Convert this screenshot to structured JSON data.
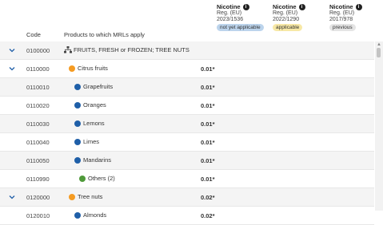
{
  "columns": {
    "code": "Code",
    "products": "Products to which MRLs apply"
  },
  "mrl_columns": [
    {
      "substance": "Nicotine",
      "reg": "Reg. (EU)",
      "num": "2023/1536",
      "status": "not yet applicable",
      "status_color": "#bcd4ec"
    },
    {
      "substance": "Nicotine",
      "reg": "Reg. (EU)",
      "num": "2022/1290",
      "status": "applicable",
      "status_color": "#f7e8a6"
    },
    {
      "substance": "Nicotine",
      "reg": "Reg. (EU)",
      "num": "2017/978",
      "status": "previous",
      "status_color": "#e4e4e4"
    }
  ],
  "rows": [
    {
      "code": "0100000",
      "product": "FRUITS, FRESH or FROZEN; TREE NUTS",
      "value": "",
      "icon": "tree-structure-icon",
      "expand": true,
      "level": 0
    },
    {
      "code": "0110000",
      "product": "Citrus fruits",
      "value": "0.01*",
      "dot": "#f59b22",
      "expand": true,
      "level": 1
    },
    {
      "code": "0110010",
      "product": "Grapefruits",
      "value": "0.01*",
      "dot": "#1f5fa8",
      "level": 2
    },
    {
      "code": "0110020",
      "product": "Oranges",
      "value": "0.01*",
      "dot": "#1f5fa8",
      "level": 2
    },
    {
      "code": "0110030",
      "product": "Lemons",
      "value": "0.01*",
      "dot": "#1f5fa8",
      "level": 2
    },
    {
      "code": "0110040",
      "product": "Limes",
      "value": "0.01*",
      "dot": "#1f5fa8",
      "level": 2
    },
    {
      "code": "0110050",
      "product": "Mandarins",
      "value": "0.01*",
      "dot": "#1f5fa8",
      "level": 2
    },
    {
      "code": "0110990",
      "product": "Others (2)",
      "value": "0.01*",
      "dot": "#4f9a3a",
      "level": 3
    },
    {
      "code": "0120000",
      "product": "Tree nuts",
      "value": "0.02*",
      "dot": "#f59b22",
      "expand": true,
      "level": 1
    },
    {
      "code": "0120010",
      "product": "Almonds",
      "value": "0.02*",
      "dot": "#1f5fa8",
      "level": 2
    }
  ]
}
